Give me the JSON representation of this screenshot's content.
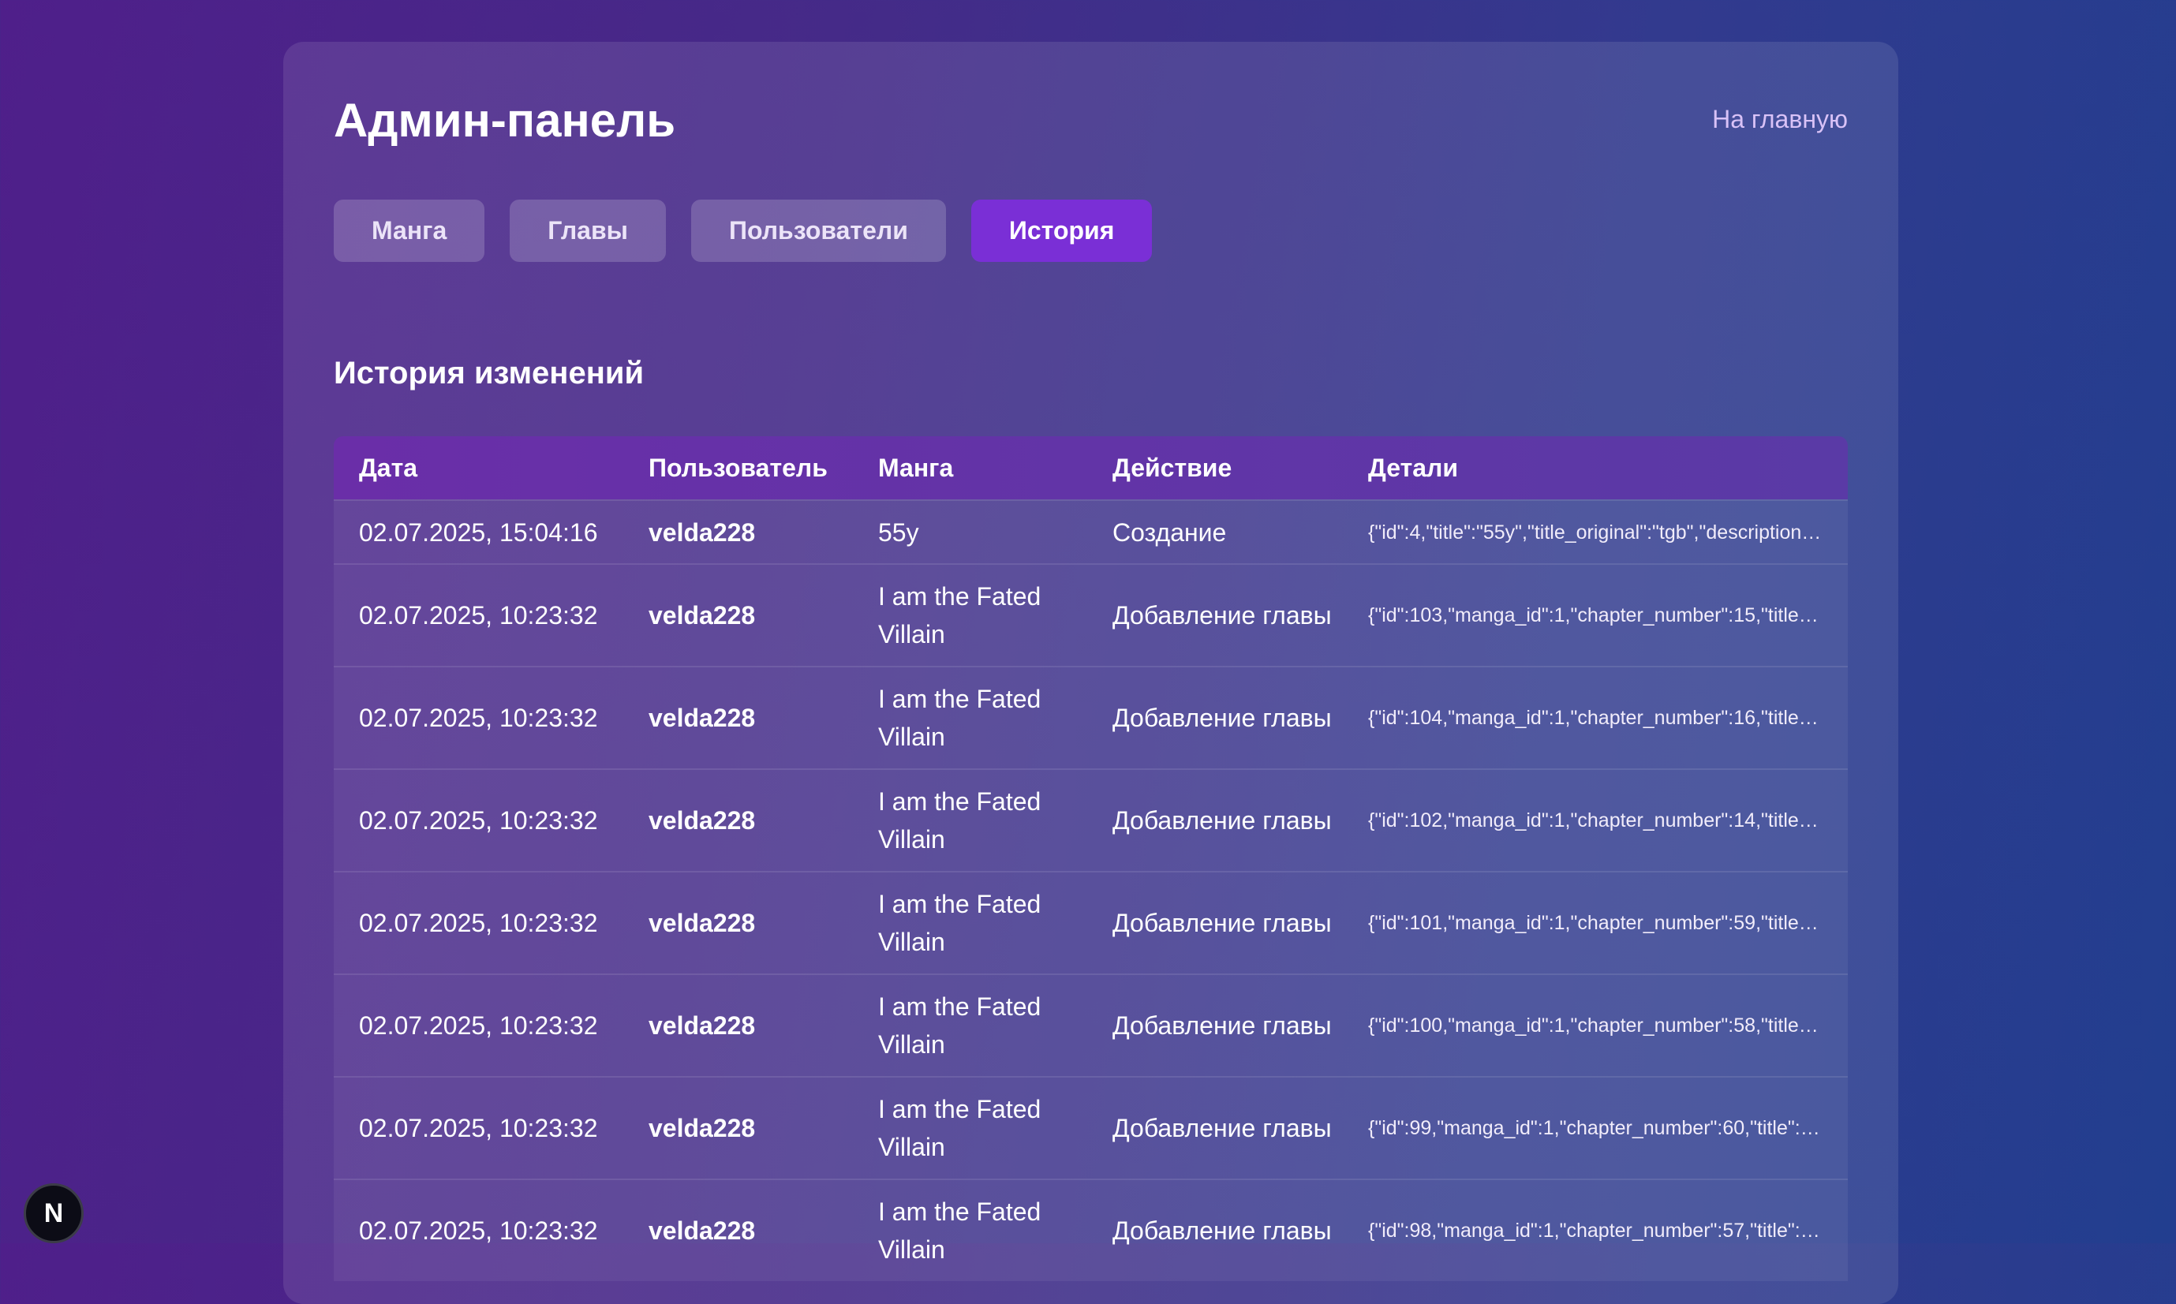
{
  "header": {
    "title": "Админ-панель",
    "home_link": "На главную"
  },
  "tabs": [
    {
      "label": "Манга",
      "active": false
    },
    {
      "label": "Главы",
      "active": false
    },
    {
      "label": "Пользователи",
      "active": false
    },
    {
      "label": "История",
      "active": true
    }
  ],
  "section_title": "История изменений",
  "table": {
    "columns": [
      "Дата",
      "Пользователь",
      "Манга",
      "Действие",
      "Детали"
    ],
    "rows": [
      {
        "date": "02.07.2025, 15:04:16",
        "user": "velda228",
        "manga": "55y",
        "action": "Создание",
        "details": "{\"id\":4,\"title\":\"55y\",\"title_original\":\"tgb\",\"description\":\"…"
      },
      {
        "date": "02.07.2025, 10:23:32",
        "user": "velda228",
        "manga": "I am the Fated Villain",
        "action": "Добавление главы",
        "details": "{\"id\":103,\"manga_id\":1,\"chapter_number\":15,\"title\":\"…"
      },
      {
        "date": "02.07.2025, 10:23:32",
        "user": "velda228",
        "manga": "I am the Fated Villain",
        "action": "Добавление главы",
        "details": "{\"id\":104,\"manga_id\":1,\"chapter_number\":16,\"title\":\"…"
      },
      {
        "date": "02.07.2025, 10:23:32",
        "user": "velda228",
        "manga": "I am the Fated Villain",
        "action": "Добавление главы",
        "details": "{\"id\":102,\"manga_id\":1,\"chapter_number\":14,\"title\":\"…"
      },
      {
        "date": "02.07.2025, 10:23:32",
        "user": "velda228",
        "manga": "I am the Fated Villain",
        "action": "Добавление главы",
        "details": "{\"id\":101,\"manga_id\":1,\"chapter_number\":59,\"title\":\"…"
      },
      {
        "date": "02.07.2025, 10:23:32",
        "user": "velda228",
        "manga": "I am the Fated Villain",
        "action": "Добавление главы",
        "details": "{\"id\":100,\"manga_id\":1,\"chapter_number\":58,\"title\":\"…"
      },
      {
        "date": "02.07.2025, 10:23:32",
        "user": "velda228",
        "manga": "I am the Fated Villain",
        "action": "Добавление главы",
        "details": "{\"id\":99,\"manga_id\":1,\"chapter_number\":60,\"title\":\"Г…"
      },
      {
        "date": "02.07.2025, 10:23:32",
        "user": "velda228",
        "manga": "I am the Fated Villain",
        "action": "Добавление главы",
        "details": "{\"id\":98,\"manga_id\":1,\"chapter_number\":57,\"title\":\"Г…"
      }
    ]
  },
  "dev_badge": {
    "label": "N",
    "icon": "nextjs-icon"
  },
  "colors": {
    "accent": "#7a2fd6",
    "link": "#d9c2f7"
  }
}
